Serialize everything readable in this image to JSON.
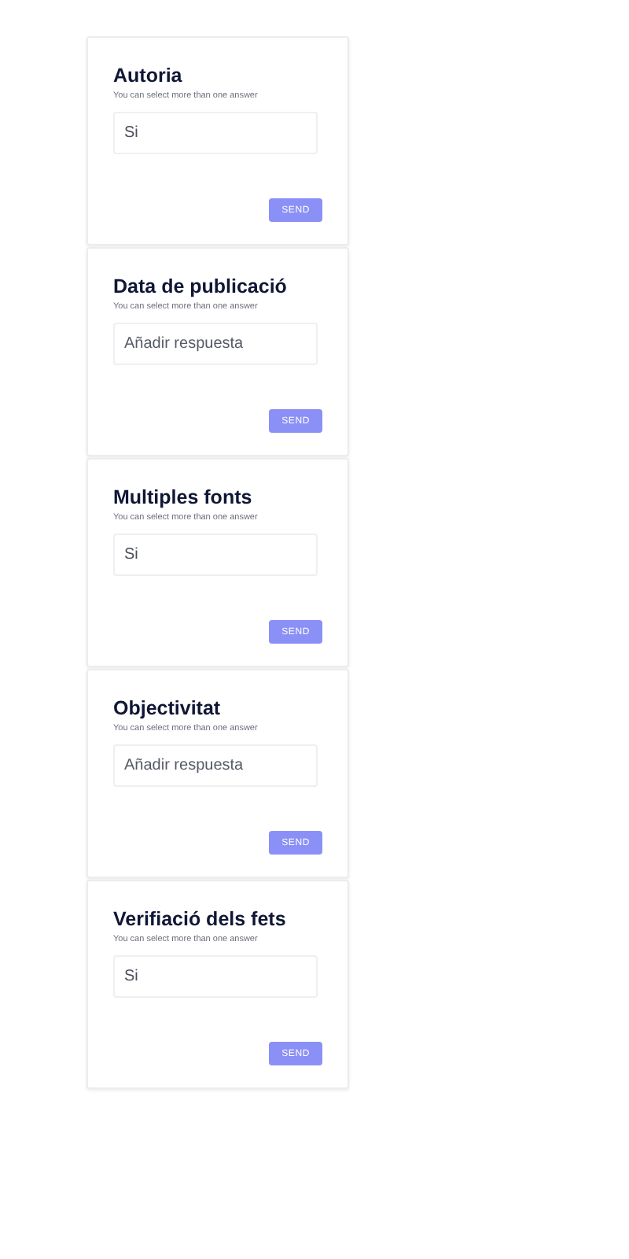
{
  "questions": [
    {
      "title": "Autoria",
      "hint": "You can select more than one answer",
      "answer": {
        "value": "Si"
      },
      "button": "SEND"
    },
    {
      "title": "Data de publicació",
      "hint": "You can select more than one answer",
      "answer": {
        "placeholder": "Añadir respuesta"
      },
      "button": "SEND"
    },
    {
      "title": "Multiples fonts",
      "hint": "You can select more than one answer",
      "answer": {
        "value": "Si"
      },
      "button": "SEND"
    },
    {
      "title": "Objectivitat",
      "hint": "You can select more than one answer",
      "answer": {
        "placeholder": "Añadir respuesta"
      },
      "button": "SEND"
    },
    {
      "title": "Verifiació dels fets",
      "hint": "You can select more than one answer",
      "answer": {
        "value": "Si"
      },
      "button": "SEND"
    }
  ]
}
